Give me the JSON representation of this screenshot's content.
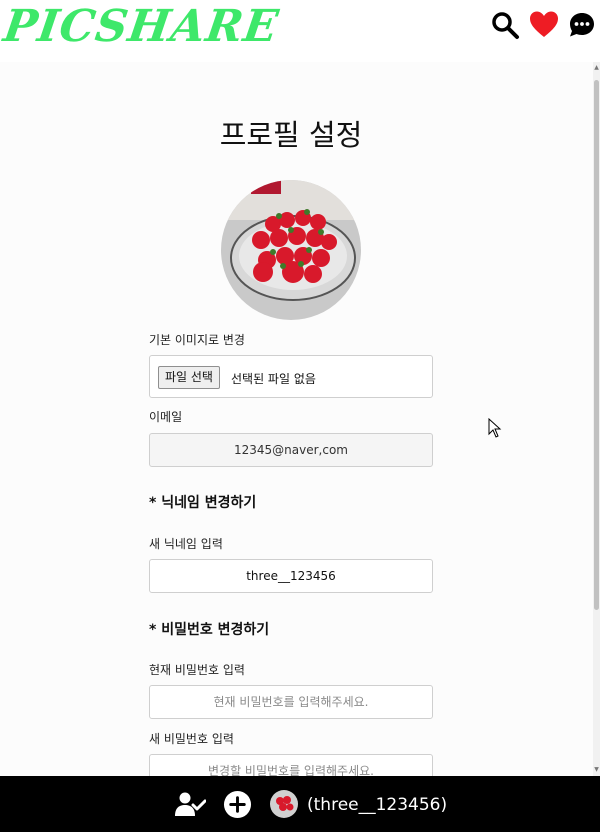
{
  "header": {
    "logo": "PICSHARE",
    "icons": [
      "search-icon",
      "heart-icon",
      "chat-bubble-icon"
    ],
    "accent_color": "#3ee86a",
    "heart_color": "#ee1c24"
  },
  "profile": {
    "title": "프로필 설정",
    "image_label": "기본 이미지로 변경",
    "file_button": "파일 선택",
    "file_status": "선택된 파일 없음",
    "email_label": "이메일",
    "email_value": "12345@naver,com"
  },
  "nickname": {
    "section_title": "* 닉네임 변경하기",
    "new_label": "새 닉네임 입력",
    "new_value": "three__123456"
  },
  "password": {
    "section_title": "* 비밀번호 변경하기",
    "current_label": "현재 비밀번호 입력",
    "current_placeholder": "현재 비밀번호를 입력해주세요.",
    "new_label": "새 비밀번호 입력",
    "new_placeholder": "변경할 비밀번호를 입력해주세요."
  },
  "footer": {
    "username": "(three__123456)",
    "icons": [
      "user-check-icon",
      "add-circle-icon",
      "profile-avatar"
    ]
  }
}
